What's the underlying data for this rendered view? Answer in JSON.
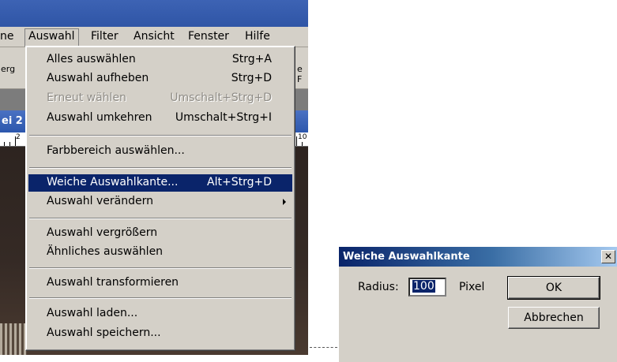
{
  "menubar": {
    "items": [
      {
        "label": "ne"
      },
      {
        "label": "Auswahl"
      },
      {
        "label": "Filter"
      },
      {
        "label": "Ansicht"
      },
      {
        "label": "Fenster"
      },
      {
        "label": "Hilfe"
      }
    ]
  },
  "toolbar": {
    "left_fragment": "erg",
    "right_fragment": "e F"
  },
  "document": {
    "tab_fragment": "ei 2",
    "ruler_left": "2",
    "ruler_right": "10"
  },
  "menu": {
    "items": [
      {
        "label": "Alles auswählen",
        "shortcut": "Strg+A"
      },
      {
        "label": "Auswahl aufheben",
        "shortcut": "Strg+D"
      },
      {
        "label": "Erneut wählen",
        "shortcut": "Umschalt+Strg+D"
      },
      {
        "label": "Auswahl umkehren",
        "shortcut": "Umschalt+Strg+I"
      },
      {
        "label": "Farbbereich auswählen..."
      },
      {
        "label": "Weiche Auswahlkante...",
        "shortcut": "Alt+Strg+D"
      },
      {
        "label": "Auswahl verändern"
      },
      {
        "label": "Auswahl vergrößern"
      },
      {
        "label": "Ähnliches auswählen"
      },
      {
        "label": "Auswahl transformieren"
      },
      {
        "label": "Auswahl laden..."
      },
      {
        "label": "Auswahl speichern..."
      }
    ]
  },
  "dialog": {
    "title": "Weiche Auswahlkante",
    "close": "✕",
    "radius_label": "Radius:",
    "radius_value": "100",
    "unit": "Pixel",
    "ok": "OK",
    "cancel": "Abbrechen"
  }
}
